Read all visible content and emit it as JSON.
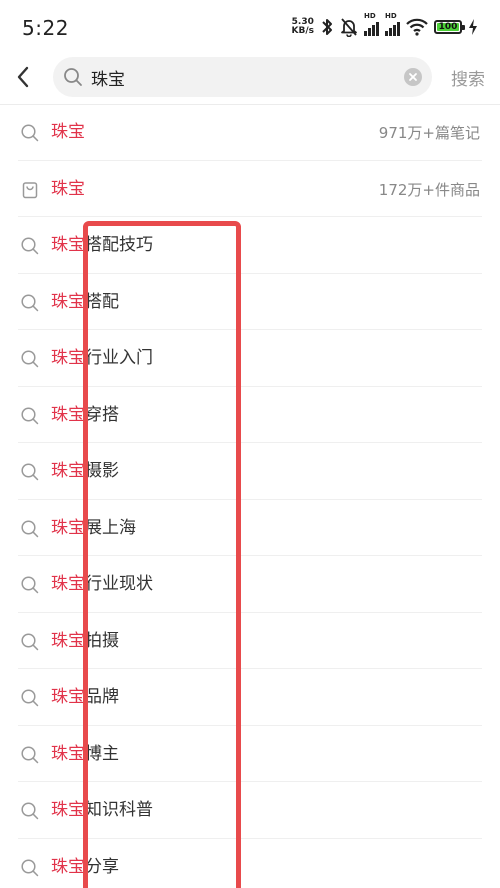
{
  "status_bar": {
    "time": "5:22",
    "net_speed_value": "5.30",
    "net_speed_unit": "KB/s",
    "signal_tag_1": "HD",
    "signal_tag_2": "HD",
    "battery_level": "100",
    "icons": [
      "bluetooth-icon",
      "mute-bell-icon",
      "signal-icon",
      "signal-icon",
      "wifi-icon",
      "battery-icon",
      "charging-icon"
    ]
  },
  "search": {
    "query": "珠宝",
    "submit_label": "搜索",
    "icons": [
      "back-arrow-icon",
      "search-icon",
      "clear-icon"
    ]
  },
  "colors": {
    "highlight": "#e1334a",
    "annotation": "#e84a4c",
    "search_bg": "#f2f2f2",
    "battery_fill": "#4cd037"
  },
  "suggestions": [
    {
      "prefix": "珠宝",
      "suffix": "",
      "meta": "971万+篇笔记",
      "icon": "search-icon"
    },
    {
      "prefix": "珠宝",
      "suffix": "",
      "meta": "172万+件商品",
      "icon": "shopping-bag-icon"
    },
    {
      "prefix": "珠宝",
      "suffix": "搭配技巧",
      "meta": "",
      "icon": "search-icon"
    },
    {
      "prefix": "珠宝",
      "suffix": "搭配",
      "meta": "",
      "icon": "search-icon"
    },
    {
      "prefix": "珠宝",
      "suffix": "行业入门",
      "meta": "",
      "icon": "search-icon"
    },
    {
      "prefix": "珠宝",
      "suffix": "穿搭",
      "meta": "",
      "icon": "search-icon"
    },
    {
      "prefix": "珠宝",
      "suffix": "摄影",
      "meta": "",
      "icon": "search-icon"
    },
    {
      "prefix": "珠宝",
      "suffix": "展上海",
      "meta": "",
      "icon": "search-icon"
    },
    {
      "prefix": "珠宝",
      "suffix": "行业现状",
      "meta": "",
      "icon": "search-icon"
    },
    {
      "prefix": "珠宝",
      "suffix": "拍摄",
      "meta": "",
      "icon": "search-icon"
    },
    {
      "prefix": "珠宝",
      "suffix": "品牌",
      "meta": "",
      "icon": "search-icon"
    },
    {
      "prefix": "珠宝",
      "suffix": "博主",
      "meta": "",
      "icon": "search-icon"
    },
    {
      "prefix": "珠宝",
      "suffix": "知识科普",
      "meta": "",
      "icon": "search-icon"
    },
    {
      "prefix": "珠宝",
      "suffix": "分享",
      "meta": "",
      "icon": "search-icon"
    }
  ]
}
